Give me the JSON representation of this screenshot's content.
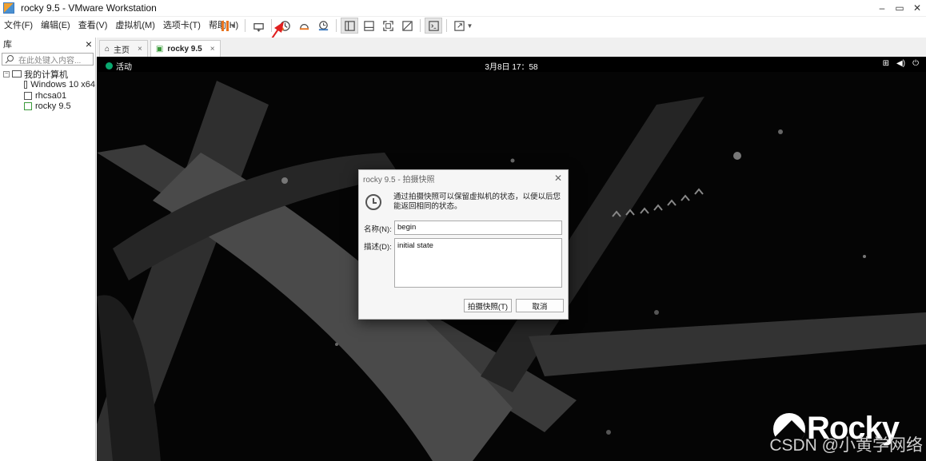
{
  "window": {
    "title": "rocky 9.5 - VMware Workstation",
    "minimize": "–",
    "restore": "▭",
    "close": "✕"
  },
  "menu": [
    "文件(F)",
    "编辑(E)",
    "查看(V)",
    "虚拟机(M)",
    "选项卡(T)",
    "帮助(H)"
  ],
  "library": {
    "title": "库",
    "close": "×",
    "search_placeholder": "在此处键入内容...",
    "tree": {
      "root": "我的计算机",
      "items": [
        "Windows 10 x64",
        "rhcsa01",
        "rocky 9.5"
      ]
    }
  },
  "tabs": [
    {
      "label": "主页"
    },
    {
      "label": "rocky 9.5"
    }
  ],
  "guest": {
    "activities": "活动",
    "clock": "3月8日  17：58",
    "logo_text": "Rocky"
  },
  "dialog": {
    "title": "rocky 9.5 - 拍摄快照",
    "info": "通过拍摄快照可以保留虚拟机的状态，以便以后您能返回相同的状态。",
    "name_label": "名称(N):",
    "name_value": "begin",
    "desc_label": "描述(D):",
    "desc_value": "initial state",
    "ok_label": "拍摄快照(T)",
    "cancel_label": "取消"
  },
  "watermark": "CSDN @小黄学网络",
  "colors": {
    "accent_orange": "#e8721c",
    "arrow_red": "#e02020",
    "rocky_green": "#0aa870"
  }
}
